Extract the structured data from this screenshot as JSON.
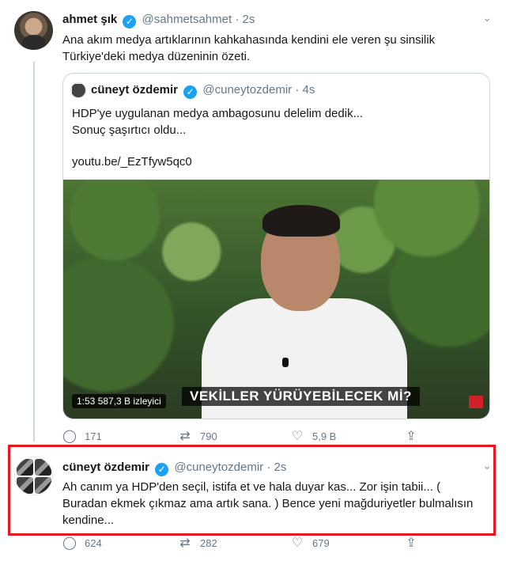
{
  "tweet1": {
    "name": "ahmet şık",
    "handle": "@sahmetsahmet",
    "time": "· 2s",
    "text_line1": "Ana akım medya artıklarının kahkahasında kendini ele veren şu sinsilik",
    "text_line2": "Türkiye'deki medya düzeninin özeti.",
    "quote": {
      "name": "cüneyt özdemir",
      "handle": "@cuneytozdemir",
      "time": "· 4s",
      "text_line1": "HDP'ye uygulanan medya ambagosunu delelim dedik...",
      "text_line2": "Sonuç şaşırtıcı oldu...",
      "link": "youtu.be/_EzTfyw5qc0",
      "video_caption": "VEKİLLER YÜRÜYEBİLECEK Mİ?",
      "video_badge": "1:53  587,3 B izleyici"
    },
    "actions": {
      "reply": "171",
      "retweet": "790",
      "like": "5,9 B"
    }
  },
  "tweet2": {
    "name": "cüneyt özdemir",
    "handle": "@cuneytozdemir",
    "time": "· 2s",
    "text_line1": "Ah canım ya HDP'den seçil, istifa et ve hala duyar kas... Zor işin tabii... (",
    "text_line2": "Buradan ekmek çıkmaz ama artık sana. ) Bence yeni mağduriyetler bulmalısın",
    "text_line3": "kendine...",
    "actions": {
      "reply": "624",
      "retweet": "282",
      "like": "679"
    }
  },
  "icons": {
    "verified": "✓",
    "chevron": "⌄",
    "reply": "◯",
    "retweet": "⇄",
    "like": "♡",
    "share": "⇪"
  },
  "colors": {
    "accent": "#1da1f2",
    "highlight": "#e8161f"
  }
}
